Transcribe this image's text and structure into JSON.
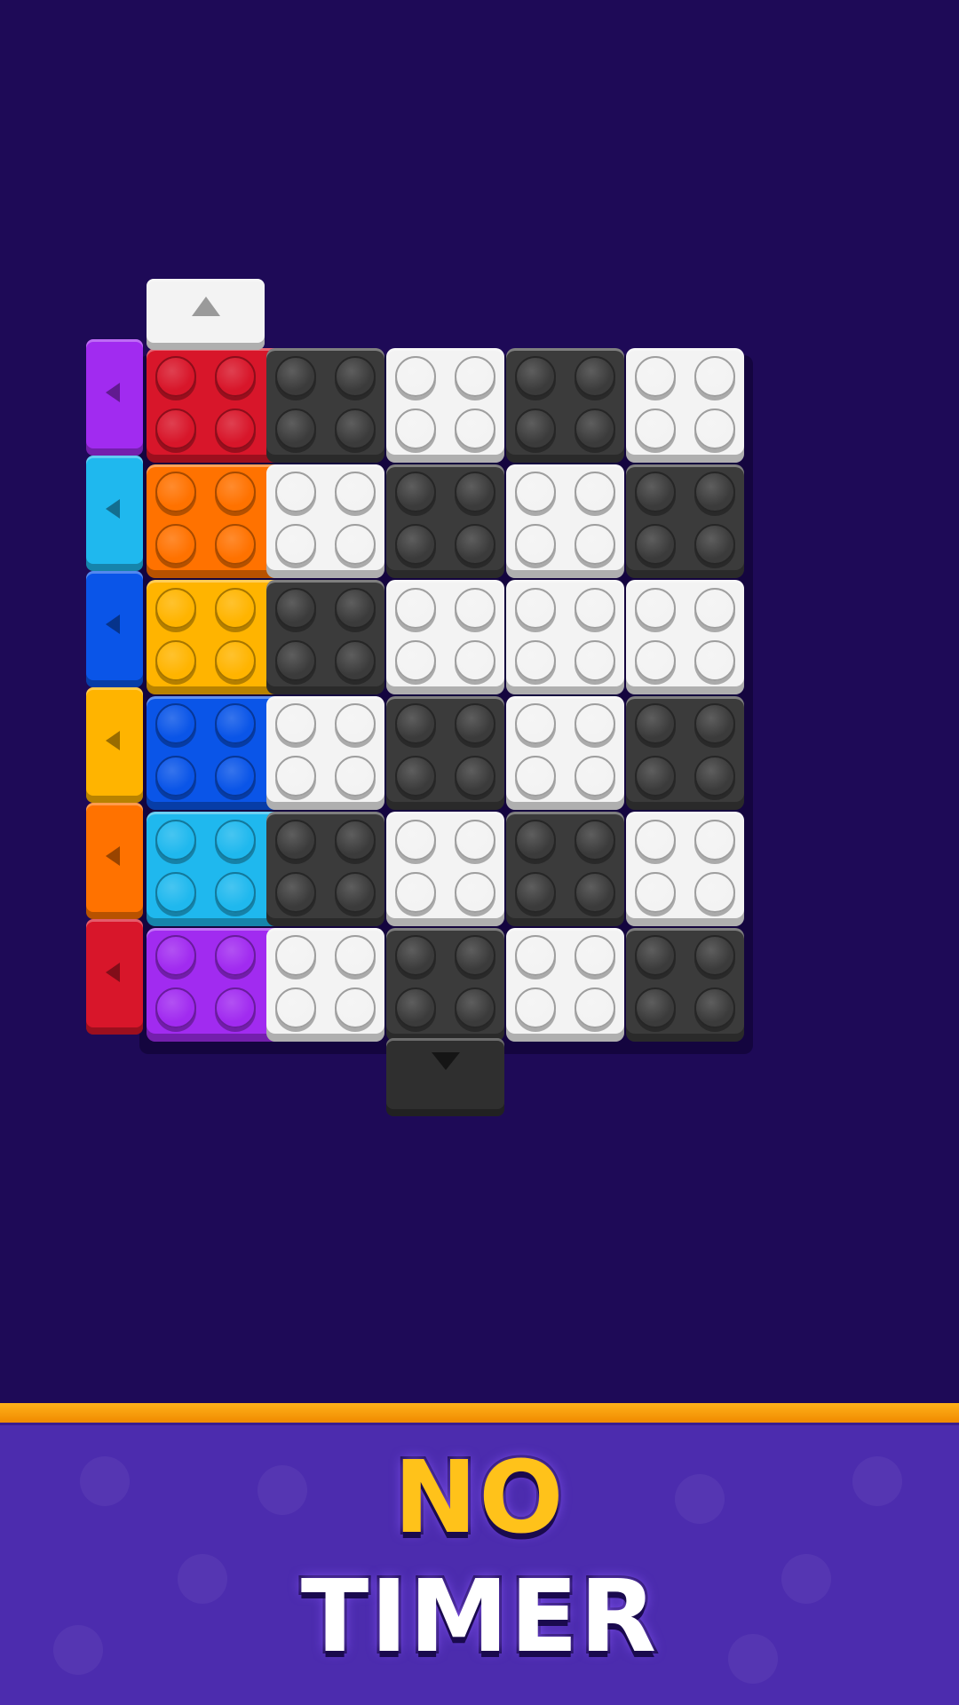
{
  "banner": {
    "line1": "NO",
    "line2": "TIMER",
    "line1_color": "#ffc21a",
    "line2_color": "#ffffff",
    "stripe_color": "#ffa10c"
  },
  "board": {
    "background": "#1e0a57",
    "rows": 6,
    "cols": 10,
    "palette": {
      "red": "#d8162a",
      "orange": "#ff7200",
      "yellow": "#ffb400",
      "blue": "#0a55e8",
      "cyan": "#1fb8ee",
      "purple": "#a12bf0",
      "black": "#3b3b3b",
      "white": "#f3f3f3"
    },
    "color_bars": [
      {
        "color": "red",
        "row": 0
      },
      {
        "color": "orange",
        "row": 1
      },
      {
        "color": "yellow",
        "row": 2
      },
      {
        "color": "blue",
        "row": 3
      },
      {
        "color": "cyan",
        "row": 4
      },
      {
        "color": "purple",
        "row": 5
      }
    ],
    "checker_cells": [
      [
        "black",
        "white",
        "black",
        "white"
      ],
      [
        "white",
        "black",
        "white",
        "black"
      ],
      [
        "black",
        "white",
        "white",
        "white"
      ],
      [
        "white",
        "black",
        "white",
        "black"
      ],
      [
        "black",
        "white",
        "black",
        "white"
      ],
      [
        "white",
        "black",
        "white",
        "black"
      ]
    ],
    "side_exits": [
      {
        "color": "purple",
        "direction": "left",
        "icon": "arrow-left-icon"
      },
      {
        "color": "cyan",
        "direction": "left",
        "icon": "arrow-left-icon"
      },
      {
        "color": "blue",
        "direction": "left",
        "icon": "arrow-left-icon"
      },
      {
        "color": "yellow",
        "direction": "left",
        "icon": "arrow-left-icon"
      },
      {
        "color": "orange",
        "direction": "left",
        "icon": "arrow-left-icon"
      },
      {
        "color": "red",
        "direction": "left",
        "icon": "arrow-left-icon"
      }
    ],
    "top_exit": {
      "color": "white",
      "direction": "up",
      "icon": "arrow-up-icon"
    },
    "bottom_exit": {
      "color": "black",
      "direction": "down",
      "icon": "arrow-down-icon"
    }
  }
}
